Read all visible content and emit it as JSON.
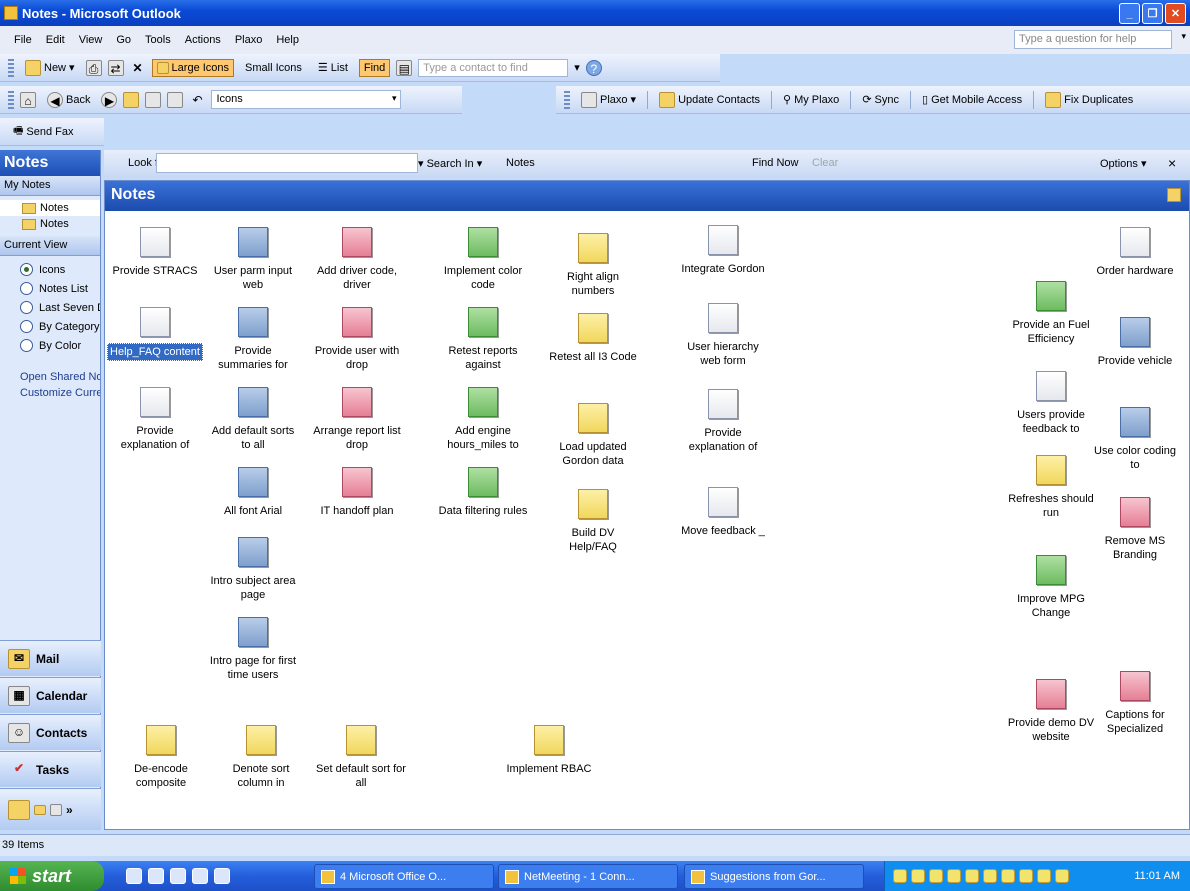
{
  "window": {
    "title": "Notes - Microsoft Outlook"
  },
  "menu": [
    "File",
    "Edit",
    "View",
    "Go",
    "Tools",
    "Actions",
    "Plaxo",
    "Help"
  ],
  "help_placeholder": "Type a question for help",
  "toolbar1": {
    "new": "New",
    "large_icons": "Large Icons",
    "small_icons": "Small Icons",
    "list": "List",
    "find": "Find",
    "contact_placeholder": "Type a contact to find"
  },
  "toolbar2": {
    "back": "Back",
    "view_value": "Icons"
  },
  "toolbar3": {
    "plaxo": "Plaxo",
    "update_contacts": "Update Contacts",
    "my_plaxo": "My Plaxo",
    "sync": "Sync",
    "get_mobile": "Get Mobile Access",
    "fix_duplicates": "Fix Duplicates"
  },
  "toolbar4": {
    "send_fax": "Send Fax"
  },
  "nav": {
    "header": "Notes",
    "my_notes_label": "My Notes",
    "folders": [
      "Notes",
      "Notes"
    ],
    "current_view_label": "Current View",
    "views": [
      "Icons",
      "Notes List",
      "Last Seven Days",
      "By Category",
      "By Color"
    ],
    "selected_view": "Icons",
    "links": [
      "Open Shared Notes",
      "Customize Current View"
    ],
    "buttons": [
      "Mail",
      "Calendar",
      "Contacts",
      "Tasks"
    ]
  },
  "search": {
    "look_for": "Look for:",
    "search_in": "Search In",
    "scope": "Notes",
    "find_now": "Find Now",
    "clear": "Clear",
    "options": "Options",
    "close": "×"
  },
  "pane": {
    "title": "Notes"
  },
  "notes": [
    {
      "text": "Provide STRACS",
      "color": "white"
    },
    {
      "text": "Help_FAQ content",
      "color": "white",
      "selected": true
    },
    {
      "text": "Provide explanation of",
      "color": "white"
    },
    {
      "text": "User parm input web",
      "color": "blue"
    },
    {
      "text": "Provide summaries for",
      "color": "blue"
    },
    {
      "text": "Add default sorts to all",
      "color": "blue"
    },
    {
      "text": "All font Arial",
      "color": "blue"
    },
    {
      "text": "Intro subject area page",
      "color": "blue"
    },
    {
      "text": "Intro page for first time users",
      "color": "blue"
    },
    {
      "text": "Add driver code, driver",
      "color": "red"
    },
    {
      "text": "Provide user with drop",
      "color": "red"
    },
    {
      "text": "Arrange report list drop",
      "color": "red"
    },
    {
      "text": "IT handoff plan",
      "color": "red"
    },
    {
      "text": "Implement color code",
      "color": "green"
    },
    {
      "text": "Retest reports against",
      "color": "green"
    },
    {
      "text": "Add engine hours_miles to",
      "color": "green"
    },
    {
      "text": "Data filtering rules",
      "color": "green"
    },
    {
      "text": "Right align numbers",
      "color": "yellow"
    },
    {
      "text": "Retest all I3 Code",
      "color": "yellow"
    },
    {
      "text": "Load updated Gordon data",
      "color": "yellow"
    },
    {
      "text": "Build DV Help/FAQ",
      "color": "yellow"
    },
    {
      "text": "Integrate Gordon",
      "color": "white"
    },
    {
      "text": "User hierarchy web form",
      "color": "white"
    },
    {
      "text": "Provide explanation of",
      "color": "white"
    },
    {
      "text": "Move feedback _",
      "color": "white"
    },
    {
      "text": "De-encode composite",
      "color": "yellow"
    },
    {
      "text": "Denote sort column in",
      "color": "yellow"
    },
    {
      "text": "Set default sort for all",
      "color": "yellow"
    },
    {
      "text": "Implement RBAC",
      "color": "yellow"
    },
    {
      "text": "Provide an Fuel Efficiency",
      "color": "green"
    },
    {
      "text": "Users provide feedback to",
      "color": "white"
    },
    {
      "text": "Refreshes should run",
      "color": "yellow"
    },
    {
      "text": "Improve MPG Change",
      "color": "green"
    },
    {
      "text": "Provide demo DV website",
      "color": "red"
    },
    {
      "text": "Order hardware",
      "color": "white"
    },
    {
      "text": "Provide vehicle",
      "color": "blue"
    },
    {
      "text": "Use color coding to",
      "color": "blue"
    },
    {
      "text": "Remove MS Branding",
      "color": "red"
    },
    {
      "text": "Captions for Specialized",
      "color": "red"
    }
  ],
  "status": {
    "items": "39 Items"
  },
  "taskbar": {
    "start": "start",
    "items": [
      "4 Microsoft Office O...",
      "NetMeeting - 1 Conn...",
      "Suggestions from Gor..."
    ],
    "clock": "11:01 AM"
  }
}
